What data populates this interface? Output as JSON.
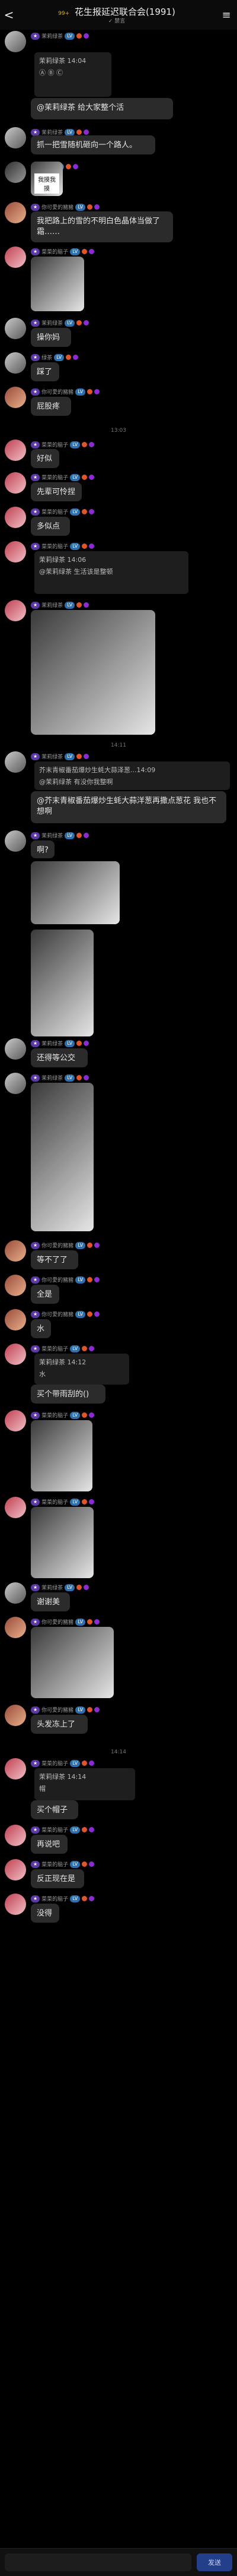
{
  "header": {
    "back": "<",
    "badge": "99+",
    "title": "花生报延迟联合会(1991)",
    "sub": "✓ 禁言",
    "menu": "≡"
  },
  "messages": [
    {
      "name": "茉莉绿茶",
      "quote_name": "茉莉绿茶 14:04",
      "quote_text": "Ⓐ Ⓑ Ⓒ",
      "text": "@茉莉绿茶 给大家整个活"
    },
    {
      "name": "茉莉绿茶",
      "text": "抓一把雪随机砸向一个路人。"
    },
    {
      "name": "绿茶",
      "image_caption": "我摸我摸"
    },
    {
      "name": "你可愛的豬豬",
      "text": "我把路上的雪的不明白色晶体当做了霜……"
    },
    {
      "name": "菜菜的脑子",
      "text": ""
    },
    {
      "name": "茉莉绿茶",
      "text": "操你妈"
    },
    {
      "name": "绿茶",
      "text": "踩了"
    },
    {
      "name": "你可愛的豬豬",
      "text": "屁股疼"
    },
    {
      "time": "13:03"
    },
    {
      "name": "菜菜的脑子",
      "text": "好似"
    },
    {
      "name": "菜菜的脑子",
      "text": "先辈可怜捏"
    },
    {
      "name": "菜菜的脑子",
      "text": "多似点"
    },
    {
      "name": "菜菜的脑子",
      "quote_name": "茉莉绿茶 14:06",
      "quote_text": "@茉莉绿茶 生活该是整顿"
    },
    {
      "name": "茉莉绿茶",
      "text": ""
    },
    {
      "time": "14:11"
    },
    {
      "name": "茉莉绿茶",
      "quote_name": "芥末青椒番茄爆炒生蚝大蒜泽葱...14:09",
      "quote_text": "@茉莉绿茶 有没你我整啊",
      "text": "@芥末青椒番茄爆炒生蚝大蒜洋葱再撒点葱花 我也不想啊"
    },
    {
      "name": "茉莉绿茶",
      "text": "啊?"
    },
    {
      "name": "茉莉绿茶",
      "text": "还得等公交"
    },
    {
      "name": "茉莉绿茶",
      "text": ""
    },
    {
      "name": "你可愛的豬豬",
      "text": "等不了了"
    },
    {
      "name": "你可愛的豬豬",
      "text": "全是"
    },
    {
      "name": "你可愛的豬豬",
      "text": "水"
    },
    {
      "name": "菜菜的脑子",
      "quote_name": "茉莉绿茶 14:12",
      "quote_text": "水",
      "text": "买个带雨刮的()"
    },
    {
      "name": "菜菜的脑子",
      "text": ""
    },
    {
      "name": "菜菜的脑子",
      "text": ""
    },
    {
      "name": "茉莉绿茶",
      "text": "谢谢美"
    },
    {
      "name": "你可愛的豬豬",
      "text": ""
    },
    {
      "name": "你可愛的豬豬",
      "text": "头发冻上了"
    },
    {
      "time": "14:14"
    },
    {
      "name": "菜菜的脑子",
      "quote_name": "茉莉绿茶 14:14",
      "quote_text": "帽",
      "text": "买个帽子"
    },
    {
      "name": "菜菜的脑子",
      "text": "再说吧"
    },
    {
      "name": "菜菜的脑子",
      "text": "反正现在是"
    },
    {
      "name": "菜菜的脑子",
      "text": "没得"
    }
  ],
  "input": {
    "send_label": "发送"
  }
}
